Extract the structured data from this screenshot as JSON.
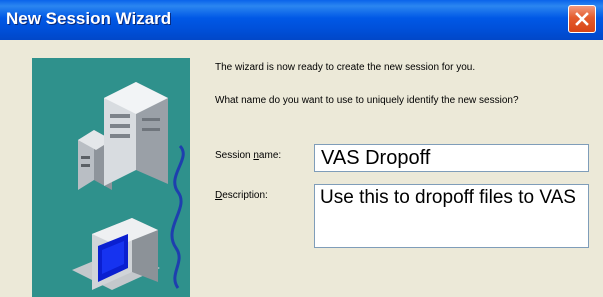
{
  "window": {
    "title": "New Session Wizard",
    "close_icon": "close-icon"
  },
  "content": {
    "intro_text": "The wizard is now ready to create the new session for you.",
    "question_text": "What name do you want to use to uniquely identify the new session?"
  },
  "form": {
    "session_name": {
      "label_before": "Session ",
      "label_accel": "n",
      "label_after": "ame:",
      "value": "VAS Dropoff"
    },
    "description": {
      "label_before": "",
      "label_accel": "D",
      "label_after": "escription:",
      "value": "Use this to dropoff files to VAS"
    }
  },
  "colors": {
    "title_bar": "#0058e6",
    "art_background": "#2f918c",
    "close_button": "#e45c2d"
  }
}
